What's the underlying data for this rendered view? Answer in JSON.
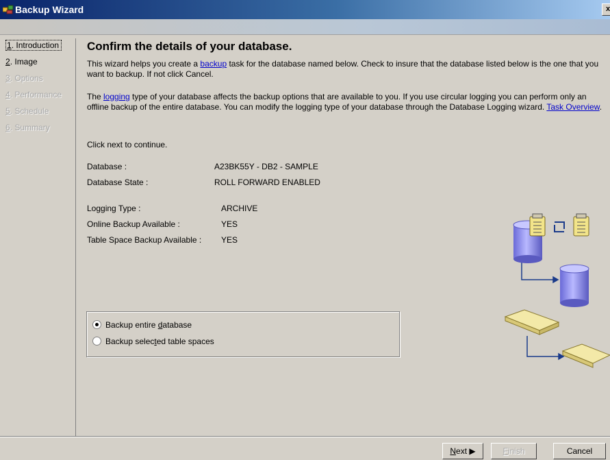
{
  "window": {
    "title": "Backup Wizard",
    "close_label": "x"
  },
  "nav": {
    "items": [
      {
        "num": "1",
        "label": ". Introduction",
        "state": "current"
      },
      {
        "num": "2",
        "label": ". Image",
        "state": "enabled"
      },
      {
        "num": "3",
        "label": ". Options",
        "state": "disabled"
      },
      {
        "num": "4",
        "label": ". Performance",
        "state": "disabled"
      },
      {
        "num": "5",
        "label": ". Schedule",
        "state": "disabled"
      },
      {
        "num": "6",
        "label": ". Summary",
        "state": "disabled"
      }
    ]
  },
  "main": {
    "heading": "Confirm the details of your database.",
    "p1": {
      "before": "This wizard helps you create a ",
      "link": "backup",
      "after": " task for the database named below.  Check to insure that the database listed below is the one that you want to backup.  If not click Cancel."
    },
    "p2": {
      "before": "The ",
      "link": "logging",
      "after": " type of your database affects the backup options that are available to you.  If you use circular logging you can perform only an offline backup of the entire database.  You can modify the logging type of your database through the Database Logging wizard.  ",
      "link2": "Task Overview",
      "end": "."
    },
    "p3": "Click next to continue.",
    "fields": [
      {
        "key": "Database :",
        "value": "A23BK55Y - DB2 - SAMPLE"
      },
      {
        "key": "Database State :",
        "value": "ROLL FORWARD ENABLED"
      },
      {
        "key": "Logging Type :",
        "value": "ARCHIVE"
      },
      {
        "key": "Online Backup Available :",
        "value": "YES"
      },
      {
        "key": "Table Space Backup Available :",
        "value": "YES"
      }
    ]
  },
  "options": {
    "entire": {
      "pre": "Backup entire ",
      "u": "d",
      "post": "atabase",
      "selected": true
    },
    "selected": {
      "pre": "Backup selec",
      "u": "t",
      "post": "ed table spaces",
      "selected": false
    }
  },
  "buttons": {
    "next": {
      "u": "N",
      "rest": "ext"
    },
    "finish": {
      "u": "F",
      "rest": "inish"
    },
    "cancel": "Cancel"
  },
  "colors": {
    "titlebar_start": "#0a246a",
    "titlebar_end": "#a6caf0",
    "dialog_bg": "#d4d0c8",
    "link": "#0000cc",
    "cylinder": "#9b9bf0",
    "tray": "#f0e6a0"
  },
  "icons": [
    "app-icon",
    "clipboard-icon",
    "sync-arrows-icon",
    "database-cylinder-icon",
    "tray-icon",
    "connector-arrow-icon"
  ]
}
